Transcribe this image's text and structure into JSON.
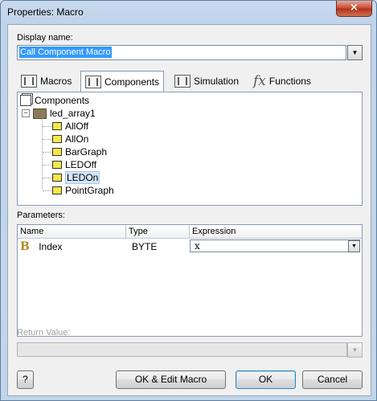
{
  "window": {
    "title": "Properties: Macro",
    "close_glyph": "×"
  },
  "display_name": {
    "label": "Display name:",
    "value": "Call Component Macro",
    "dropdown_glyph": "▼"
  },
  "tabs": [
    {
      "label": "Macros",
      "icon": "macro-icon"
    },
    {
      "label": "Components",
      "icon": "component-icon",
      "active": true
    },
    {
      "label": "Simulation",
      "icon": "simulation-icon"
    },
    {
      "label": "Functions",
      "icon": "fx-icon",
      "icon_text": "fx"
    }
  ],
  "tree": {
    "root": "Components",
    "group": "led_array1",
    "expander_glyph": "−",
    "items": [
      "AllOff",
      "AllOn",
      "BarGraph",
      "LEDOff",
      "LEDOn",
      "PointGraph"
    ],
    "selected": "LEDOn"
  },
  "parameters": {
    "label": "Parameters:",
    "columns": [
      "Name",
      "Type",
      "Expression"
    ],
    "rows": [
      {
        "icon_text": "B",
        "name": "Index",
        "type": "BYTE",
        "expression": "x"
      }
    ],
    "dropdown_glyph": "▼"
  },
  "return_value": {
    "label": "Return Value:",
    "dropdown_glyph": "▼"
  },
  "buttons": {
    "help": "?",
    "ok_edit": "OK & Edit Macro",
    "ok": "OK",
    "cancel": "Cancel"
  }
}
